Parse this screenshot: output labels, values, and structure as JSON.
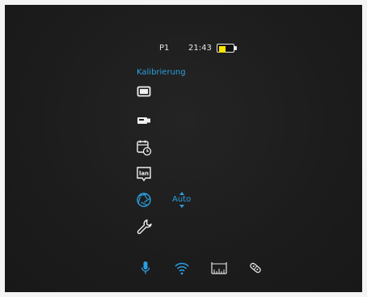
{
  "status": {
    "preset": "P1",
    "time": "21:43",
    "battery_level": 0.45,
    "battery_color": "#ffe600"
  },
  "menu": {
    "title": "Kalibrierung",
    "items": [
      {
        "icon": "display-icon"
      },
      {
        "icon": "camera-icon"
      },
      {
        "icon": "calendar-clock-icon"
      },
      {
        "icon": "language-icon"
      },
      {
        "icon": "aperture-icon",
        "value": "Auto"
      },
      {
        "icon": "wrench-icon"
      }
    ]
  },
  "bottom_bar": [
    {
      "icon": "microphone-icon"
    },
    {
      "icon": "wifi-icon"
    },
    {
      "icon": "rangefinder-icon"
    },
    {
      "icon": "laser-icon"
    }
  ],
  "colors": {
    "accent": "#2a9fe0",
    "text": "#e6e6e6",
    "background": "#1d1d1d"
  }
}
